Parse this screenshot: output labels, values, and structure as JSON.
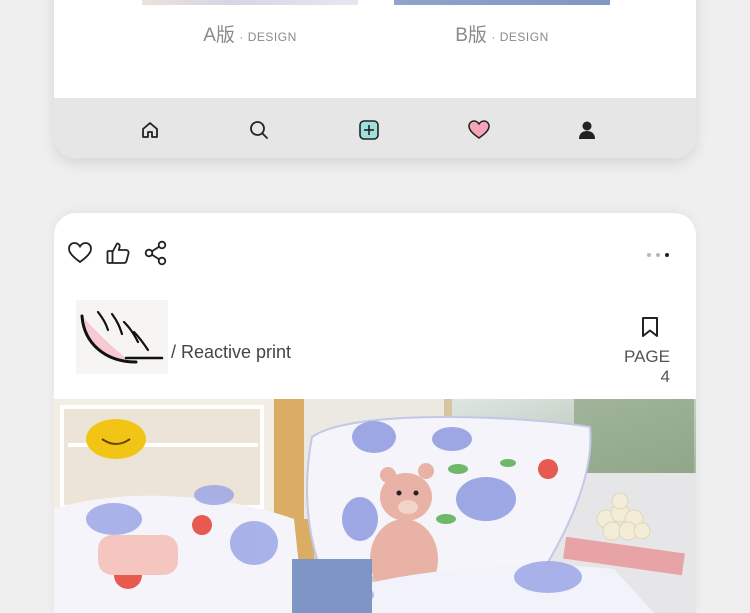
{
  "versions": [
    {
      "letter": "A版",
      "tag": "· DESIGN"
    },
    {
      "letter": "B版",
      "tag": "· DESIGN"
    }
  ],
  "tabbar": {
    "icons": [
      "home-icon",
      "search-icon",
      "add-icon",
      "heart-icon",
      "profile-icon"
    ],
    "accent_add": "#9fe0dc",
    "accent_heart": "#f4a6b8"
  },
  "post": {
    "actions": [
      "heart-icon",
      "thumbs-up-icon",
      "share-icon"
    ],
    "caption": "/ Reactive print",
    "page": "PAGE 4",
    "carousel_dots": 3,
    "carousel_active": 3
  }
}
